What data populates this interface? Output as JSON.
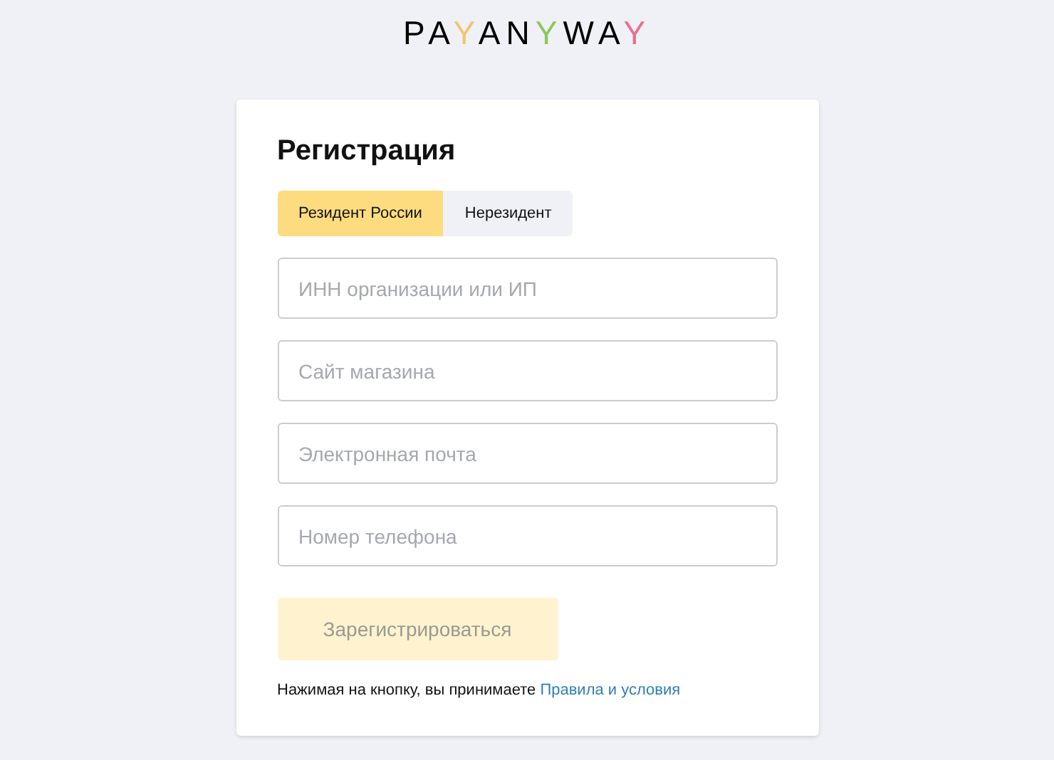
{
  "logo": [
    {
      "text": "PA"
    },
    {
      "text": "Y",
      "color": "#f2c66d"
    },
    {
      "text": "AN"
    },
    {
      "text": "Y",
      "color": "#8ec65a"
    },
    {
      "text": "WA"
    },
    {
      "text": "Y",
      "color": "#e8708f"
    }
  ],
  "title": "Регистрация",
  "tabs": [
    {
      "label": "Резидент России",
      "selected": true
    },
    {
      "label": "Нерезидент",
      "selected": false
    }
  ],
  "fields": [
    {
      "placeholder": "ИНН организации или ИП"
    },
    {
      "placeholder": "Сайт магазина"
    },
    {
      "placeholder": "Электронная почта"
    },
    {
      "placeholder": "Номер телефона"
    }
  ],
  "submit": {
    "label": "Зарегистрироваться",
    "disabled": true
  },
  "terms": {
    "text": "Нажимая на кнопку, вы принимаете",
    "link": "Правила и условия"
  }
}
